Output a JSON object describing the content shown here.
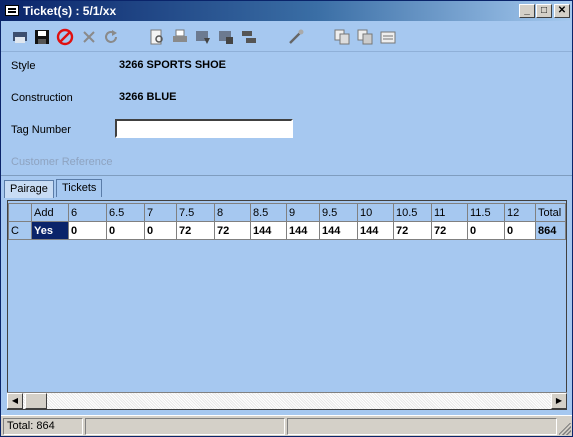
{
  "window": {
    "title": "Ticket(s) : 5/1/xx"
  },
  "titlebar_buttons": {
    "minimize": "_",
    "maximize": "□",
    "close": "✕"
  },
  "toolbar": {
    "tools": [
      "printer-icon",
      "save-icon",
      "cancel-icon",
      "delete-icon",
      "refresh-icon",
      "preview-icon",
      "print-icon",
      "export-icon",
      "export2-icon",
      "layout-icon",
      "tools-icon",
      "copy-icon",
      "copy2-icon",
      "report-icon"
    ]
  },
  "form": {
    "style_label": "Style",
    "style_value": "3266 SPORTS SHOE",
    "construction_label": "Construction",
    "construction_value": "3266 BLUE",
    "tag_label": "Tag Number",
    "tag_value": "",
    "customer_ref_label": "Customer Reference"
  },
  "tabs": [
    {
      "label": "Pairage",
      "active": true
    },
    {
      "label": "Tickets",
      "active": false
    }
  ],
  "grid": {
    "columns": [
      "",
      "Add",
      "6",
      "6.5",
      "7",
      "7.5",
      "8",
      "8.5",
      "9",
      "9.5",
      "10",
      "10.5",
      "11",
      "11.5",
      "12",
      "Total"
    ],
    "rows": [
      [
        "C",
        "Yes",
        "0",
        "0",
        "0",
        "72",
        "72",
        "144",
        "144",
        "144",
        "144",
        "72",
        "72",
        "0",
        "0",
        "864"
      ]
    ]
  },
  "statusbar": {
    "total": "Total: 864"
  },
  "colors": {
    "window_bg": "#a6c8f0",
    "title_start": "#0a246a",
    "selection": "#0a246a"
  }
}
